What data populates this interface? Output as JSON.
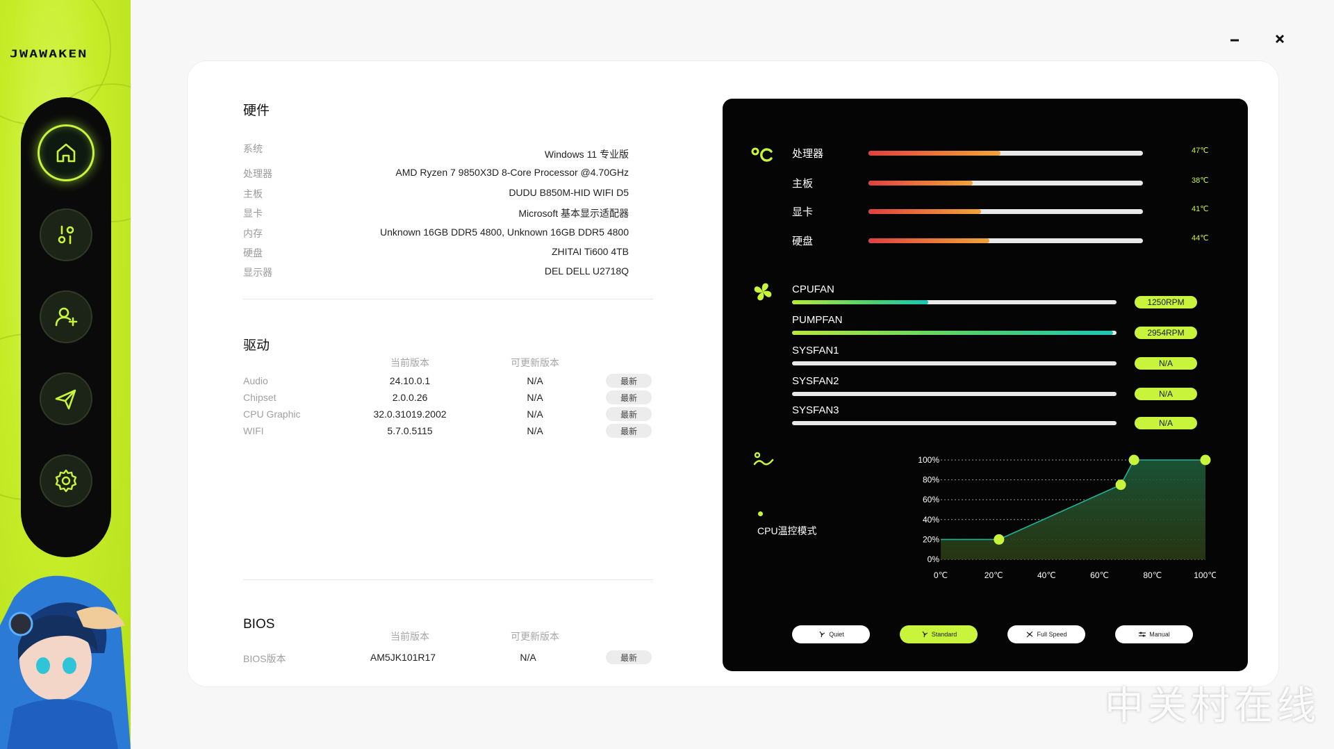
{
  "app": {
    "logo_text": "JWAWAKEN"
  },
  "window": {
    "minimize_label": "–",
    "close_label": "✕"
  },
  "sidebar": {
    "items": [
      {
        "name": "home",
        "icon": "home-icon",
        "active": true
      },
      {
        "name": "tuning",
        "icon": "sliders-icon",
        "active": false
      },
      {
        "name": "user",
        "icon": "add-user-icon",
        "active": false
      },
      {
        "name": "send",
        "icon": "send-icon",
        "active": false
      },
      {
        "name": "settings",
        "icon": "gear-icon",
        "active": false
      }
    ]
  },
  "hardware": {
    "title": "硬件",
    "rows": [
      {
        "key": "系统",
        "value": "Windows 11 专业版"
      },
      {
        "key": "处理器",
        "value": "AMD Ryzen 7 9850X3D 8-Core Processor @4.70GHz"
      },
      {
        "key": "主板",
        "value": "DUDU B850M-HID WIFI D5"
      },
      {
        "key": "显卡",
        "value": "Microsoft 基本显示适配器"
      },
      {
        "key": "内存",
        "value": "Unknown 16GB DDR5 4800, Unknown 16GB DDR5 4800"
      },
      {
        "key": "硬盘",
        "value": "ZHITAI Ti600 4TB"
      },
      {
        "key": "显示器",
        "value": "DEL DELL U2718Q"
      }
    ]
  },
  "drivers": {
    "title": "驱动",
    "col_current": "当前版本",
    "col_update": "可更新版本",
    "rows": [
      {
        "name": "Audio",
        "current": "24.10.0.1",
        "update": "N/A",
        "action": "最新"
      },
      {
        "name": "Chipset",
        "current": "2.0.0.26",
        "update": "N/A",
        "action": "最新"
      },
      {
        "name": "CPU Graphic",
        "current": "32.0.31019.2002",
        "update": "N/A",
        "action": "最新"
      },
      {
        "name": "WIFI",
        "current": "5.7.0.5115",
        "update": "N/A",
        "action": "最新"
      }
    ]
  },
  "bios": {
    "title": "BIOS",
    "col_current": "当前版本",
    "col_update": "可更新版本",
    "row": {
      "name": "BIOS版本",
      "current": "AM5JK101R17",
      "update": "N/A",
      "action": "最新"
    }
  },
  "temps": [
    {
      "label": "处理器",
      "value": "47℃",
      "level": 0.48
    },
    {
      "label": "主板",
      "value": "38℃",
      "level": 0.38
    },
    {
      "label": "显卡",
      "value": "41℃",
      "level": 0.41
    },
    {
      "label": "硬盘",
      "value": "44℃",
      "level": 0.44
    }
  ],
  "fans": [
    {
      "label": "CPUFAN",
      "value": "1250RPM",
      "level": 0.42
    },
    {
      "label": "PUMPFAN",
      "value": "2954RPM",
      "level": 0.99
    },
    {
      "label": "SYSFAN1",
      "value": "N/A",
      "level": 0
    },
    {
      "label": "SYSFAN2",
      "value": "N/A",
      "level": 0
    },
    {
      "label": "SYSFAN3",
      "value": "N/A",
      "level": 0
    }
  ],
  "curve": {
    "mode_label": "CPU温控模式"
  },
  "chart_data": {
    "type": "area",
    "title": "",
    "xlabel": "",
    "ylabel": "",
    "x_ticks": [
      "0℃",
      "20℃",
      "40℃",
      "60℃",
      "80℃",
      "100℃"
    ],
    "y_ticks": [
      "100%",
      "80%",
      "60%",
      "40%",
      "20%",
      "0%"
    ],
    "xlim": [
      0,
      100
    ],
    "ylim": [
      0,
      100
    ],
    "grid": true,
    "series": [
      {
        "points": [
          [
            0,
            20
          ],
          [
            22,
            20
          ],
          [
            68,
            75
          ],
          [
            73,
            100
          ],
          [
            100,
            100
          ]
        ]
      }
    ],
    "handles": [
      [
        22,
        20
      ],
      [
        68,
        75
      ],
      [
        73,
        100
      ],
      [
        100,
        100
      ]
    ]
  },
  "modes": [
    {
      "label": "Quiet",
      "icon": "quiet-fan-icon",
      "active": false
    },
    {
      "label": "Standard",
      "icon": "standard-fan-icon",
      "active": true
    },
    {
      "label": "Full Speed",
      "icon": "full-speed-fan-icon",
      "active": false
    },
    {
      "label": "Manual",
      "icon": "manual-fan-icon",
      "active": false
    }
  ],
  "colors": {
    "accent": "#c8f43c",
    "panel": "#050505",
    "sidebar": "#c6ec28",
    "area_fill": "#1d3a22"
  },
  "watermark": "中关村在线"
}
